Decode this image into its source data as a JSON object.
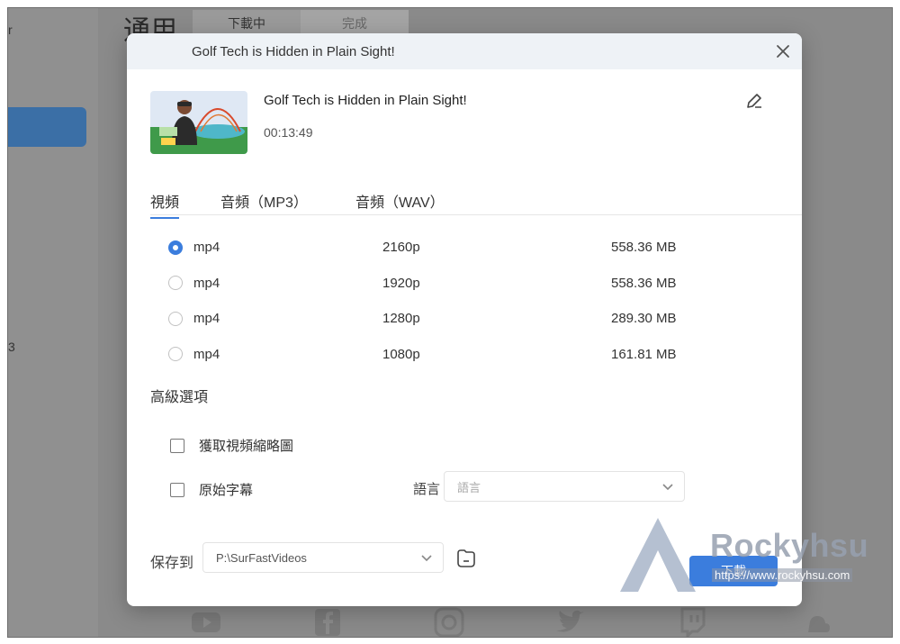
{
  "app": {
    "title": "通用",
    "left_char": "r",
    "left_num": "3",
    "tabs": [
      {
        "label": "下載中"
      },
      {
        "label": "完成"
      }
    ]
  },
  "dialog": {
    "header_title": "Golf Tech is Hidden in Plain Sight!",
    "video": {
      "title": "Golf Tech is Hidden in Plain Sight!",
      "duration": "00:13:49"
    },
    "tabs": [
      {
        "label": "視頻",
        "active": true
      },
      {
        "label": "音頻（MP3）",
        "active": false
      },
      {
        "label": "音頻（WAV）",
        "active": false
      }
    ],
    "formats": [
      {
        "format": "mp4",
        "resolution": "2160p",
        "size": "558.36 MB",
        "selected": true
      },
      {
        "format": "mp4",
        "resolution": "1920p",
        "size": "558.36 MB",
        "selected": false
      },
      {
        "format": "mp4",
        "resolution": "1280p",
        "size": "289.30 MB",
        "selected": false
      },
      {
        "format": "mp4",
        "resolution": "1080p",
        "size": "161.81 MB",
        "selected": false
      }
    ],
    "advanced": {
      "title": "高級選項",
      "thumbnail_label": "獲取視頻縮略圖",
      "subtitle_label": "原始字幕",
      "language_label": "語言",
      "language_placeholder": "語言"
    },
    "save": {
      "label": "保存到",
      "path": "P:\\SurFastVideos"
    },
    "download_label": "下載"
  },
  "watermark": {
    "name": "Rockyhsu",
    "url": "https://www.rockyhsu.com"
  },
  "colors": {
    "accent": "#3b7ddd",
    "header_bg": "#eef2f6",
    "overlay": "#8a8a8a"
  }
}
